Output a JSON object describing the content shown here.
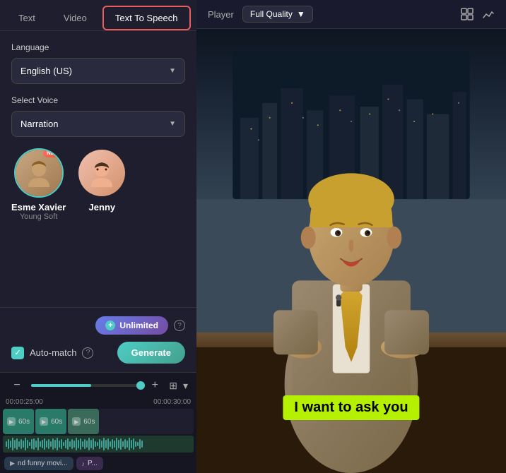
{
  "tabs": [
    {
      "id": "text",
      "label": "Text",
      "active": false
    },
    {
      "id": "video",
      "label": "Video",
      "active": false
    },
    {
      "id": "tts",
      "label": "Text To Speech",
      "active": true
    }
  ],
  "left_panel": {
    "language_label": "Language",
    "language_value": "English (US)",
    "select_voice_label": "Select Voice",
    "voice_type": "Narration",
    "voices": [
      {
        "id": "esme",
        "name": "Esme Xavier",
        "subtitle": "Young Soft",
        "is_new": true,
        "selected": true,
        "emoji": "👩"
      },
      {
        "id": "jenny",
        "name": "Jenny",
        "subtitle": "",
        "is_new": false,
        "selected": false,
        "emoji": "👧"
      }
    ],
    "unlimited_label": "Unlimited",
    "help_label": "?",
    "auto_match_label": "Auto-match",
    "generate_label": "Generate"
  },
  "timeline": {
    "time_start": "00:00:25:00",
    "time_end": "00:00:30:00",
    "segments": [
      {
        "label": "60s",
        "show_play": true
      },
      {
        "label": "60s",
        "show_play": true
      },
      {
        "label": "60s",
        "show_play": true
      }
    ],
    "clips": [
      {
        "label": "nd funny movi...",
        "type": "video",
        "icon": "🎬"
      },
      {
        "label": "P...",
        "type": "music",
        "icon": "♪"
      }
    ]
  },
  "player": {
    "label": "Player",
    "quality": "Full Quality",
    "subtitle_text": "I want to ask you"
  }
}
